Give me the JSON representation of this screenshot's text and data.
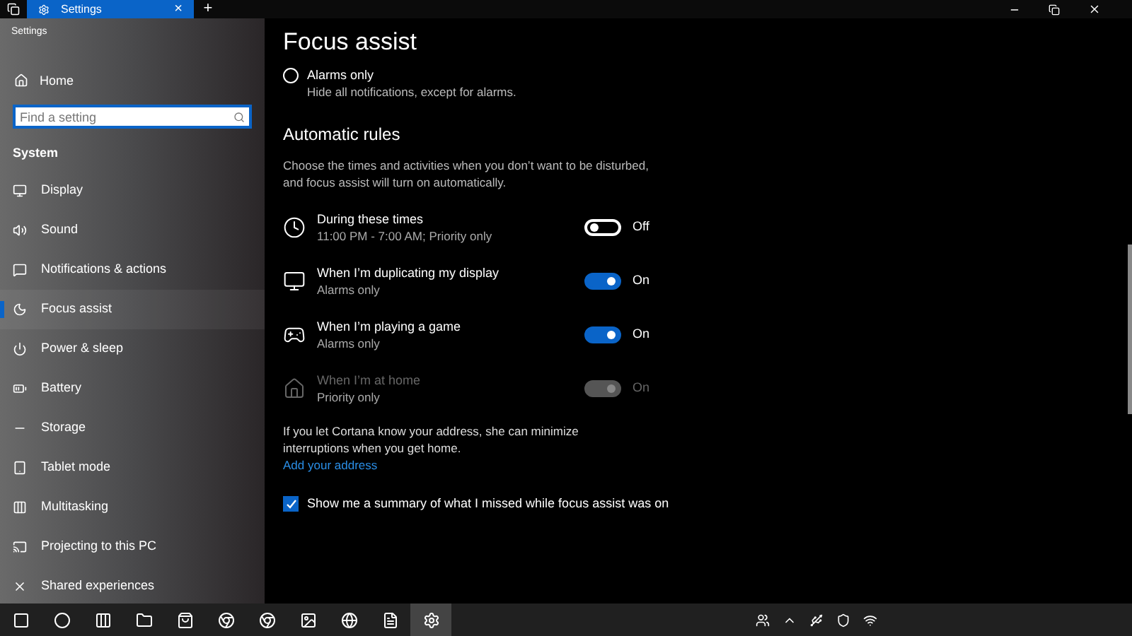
{
  "browser_tab": {
    "title": "Settings",
    "close": "×",
    "new_tab": "+"
  },
  "app_title": "Settings",
  "sidebar": {
    "home": "Home",
    "search": {
      "placeholder": "Find a setting"
    },
    "section": "System",
    "items": [
      {
        "label": "Display",
        "selected": false
      },
      {
        "label": "Sound",
        "selected": false
      },
      {
        "label": "Notifications & actions",
        "selected": false
      },
      {
        "label": "Focus assist",
        "selected": true
      },
      {
        "label": "Power & sleep",
        "selected": false
      },
      {
        "label": "Battery",
        "selected": false
      },
      {
        "label": "Storage",
        "selected": false
      },
      {
        "label": "Tablet mode",
        "selected": false
      },
      {
        "label": "Multitasking",
        "selected": false
      },
      {
        "label": "Projecting to this PC",
        "selected": false
      },
      {
        "label": "Shared experiences",
        "selected": false
      }
    ]
  },
  "page": {
    "title": "Focus assist",
    "option": {
      "label": "Alarms only",
      "description": "Hide all notifications, except for alarms.",
      "selected": false
    },
    "section": "Automatic rules",
    "section_description": "Choose the times and activities when you don’t want to be disturbed, and focus assist will turn on automatically.",
    "rules": [
      {
        "kind": "clock",
        "title": "During these times",
        "subtitle": "11:00 PM - 7:00 AM; Priority only",
        "on": false,
        "disabled": false,
        "state_label": "Off"
      },
      {
        "kind": "display",
        "title": "When I’m duplicating my display",
        "subtitle": "Alarms only",
        "on": true,
        "disabled": false,
        "state_label": "On"
      },
      {
        "kind": "game",
        "title": "When I’m playing a game",
        "subtitle": "Alarms only",
        "on": true,
        "disabled": false,
        "state_label": "On"
      },
      {
        "kind": "home",
        "title": "When I’m at home",
        "subtitle": "Priority only",
        "on": true,
        "disabled": true,
        "state_label": "On"
      }
    ],
    "cortana_note": "If you let Cortana know your address, she can minimize interruptions when you get home.",
    "link": "Add your address",
    "summary_checkbox": {
      "label": "Show me a summary of what I missed while focus assist was on",
      "checked": true
    }
  },
  "taskbar": {
    "buttons": [
      {
        "selected": false
      },
      {
        "selected": false
      },
      {
        "selected": false
      },
      {
        "selected": false
      },
      {
        "selected": false
      },
      {
        "selected": false
      },
      {
        "selected": false
      },
      {
        "selected": false
      },
      {
        "selected": false
      },
      {
        "selected": false
      },
      {
        "selected": true
      }
    ]
  }
}
